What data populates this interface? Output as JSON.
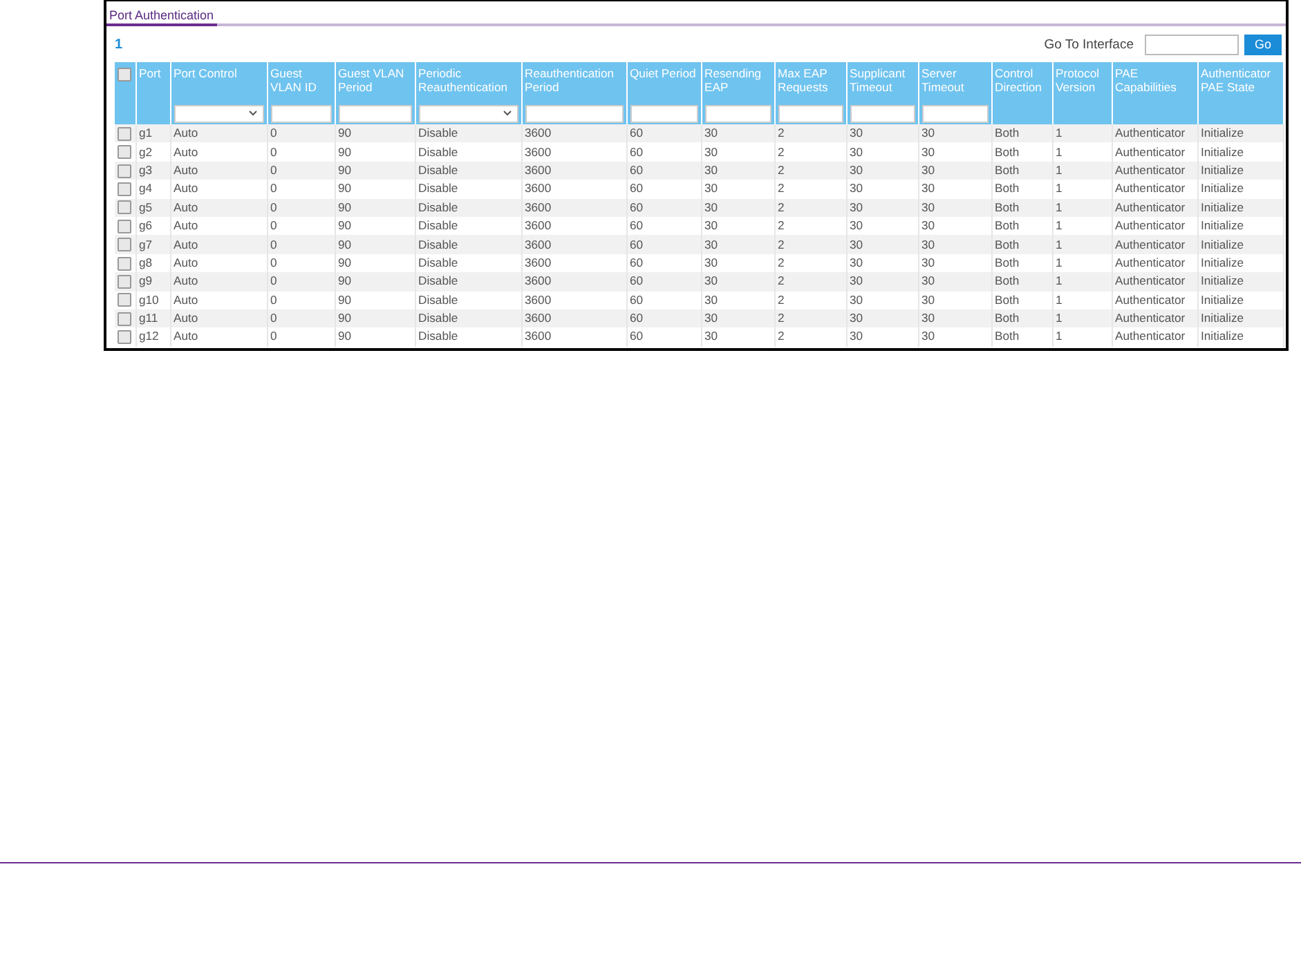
{
  "tabs": [
    {
      "label": "Port Authentication",
      "selected": true
    }
  ],
  "pagination": {
    "pages": [
      {
        "label": "1",
        "selected": true
      }
    ]
  },
  "go_to_interface": {
    "label": "Go To Interface",
    "button": "Go"
  },
  "table": {
    "select_all": {
      "checked": false
    },
    "columns": [
      "Port",
      "Port Control",
      "Guest VLAN ID",
      "Guest VLAN Period",
      "Periodic Reauthentication",
      "Reauthentication Period",
      "Quiet Period",
      "Resending EAP",
      "Max EAP Requests",
      "Supplicant Timeout",
      "Server Timeout",
      "Control Direction",
      "Protocol Version",
      "PAE Capabilities",
      "Authenticator PAE State"
    ],
    "filters": [
      {
        "kind": "none"
      },
      {
        "kind": "select"
      },
      {
        "kind": "input"
      },
      {
        "kind": "input"
      },
      {
        "kind": "select"
      },
      {
        "kind": "input"
      },
      {
        "kind": "input"
      },
      {
        "kind": "input"
      },
      {
        "kind": "input"
      },
      {
        "kind": "input"
      },
      {
        "kind": "input"
      },
      {
        "kind": "none"
      },
      {
        "kind": "none"
      },
      {
        "kind": "none"
      },
      {
        "kind": "none"
      }
    ],
    "rows": [
      {
        "checked": false,
        "cells": [
          "g1",
          "Auto",
          "0",
          "90",
          "Disable",
          "3600",
          "60",
          "30",
          "2",
          "30",
          "30",
          "Both",
          "1",
          "Authenticator",
          "Initialize"
        ]
      },
      {
        "checked": false,
        "cells": [
          "g2",
          "Auto",
          "0",
          "90",
          "Disable",
          "3600",
          "60",
          "30",
          "2",
          "30",
          "30",
          "Both",
          "1",
          "Authenticator",
          "Initialize"
        ]
      },
      {
        "checked": false,
        "cells": [
          "g3",
          "Auto",
          "0",
          "90",
          "Disable",
          "3600",
          "60",
          "30",
          "2",
          "30",
          "30",
          "Both",
          "1",
          "Authenticator",
          "Initialize"
        ]
      },
      {
        "checked": false,
        "cells": [
          "g4",
          "Auto",
          "0",
          "90",
          "Disable",
          "3600",
          "60",
          "30",
          "2",
          "30",
          "30",
          "Both",
          "1",
          "Authenticator",
          "Initialize"
        ]
      },
      {
        "checked": false,
        "cells": [
          "g5",
          "Auto",
          "0",
          "90",
          "Disable",
          "3600",
          "60",
          "30",
          "2",
          "30",
          "30",
          "Both",
          "1",
          "Authenticator",
          "Initialize"
        ]
      },
      {
        "checked": false,
        "cells": [
          "g6",
          "Auto",
          "0",
          "90",
          "Disable",
          "3600",
          "60",
          "30",
          "2",
          "30",
          "30",
          "Both",
          "1",
          "Authenticator",
          "Initialize"
        ]
      },
      {
        "checked": false,
        "cells": [
          "g7",
          "Auto",
          "0",
          "90",
          "Disable",
          "3600",
          "60",
          "30",
          "2",
          "30",
          "30",
          "Both",
          "1",
          "Authenticator",
          "Initialize"
        ]
      },
      {
        "checked": false,
        "cells": [
          "g8",
          "Auto",
          "0",
          "90",
          "Disable",
          "3600",
          "60",
          "30",
          "2",
          "30",
          "30",
          "Both",
          "1",
          "Authenticator",
          "Initialize"
        ]
      },
      {
        "checked": false,
        "cells": [
          "g9",
          "Auto",
          "0",
          "90",
          "Disable",
          "3600",
          "60",
          "30",
          "2",
          "30",
          "30",
          "Both",
          "1",
          "Authenticator",
          "Initialize"
        ]
      },
      {
        "checked": false,
        "cells": [
          "g10",
          "Auto",
          "0",
          "90",
          "Disable",
          "3600",
          "60",
          "30",
          "2",
          "30",
          "30",
          "Both",
          "1",
          "Authenticator",
          "Initialize"
        ]
      },
      {
        "checked": false,
        "cells": [
          "g11",
          "Auto",
          "0",
          "90",
          "Disable",
          "3600",
          "60",
          "30",
          "2",
          "30",
          "30",
          "Both",
          "1",
          "Authenticator",
          "Initialize"
        ]
      },
      {
        "checked": false,
        "cells": [
          "g12",
          "Auto",
          "0",
          "90",
          "Disable",
          "3600",
          "60",
          "30",
          "2",
          "30",
          "30",
          "Both",
          "1",
          "Authenticator",
          "Initialize"
        ]
      }
    ]
  }
}
